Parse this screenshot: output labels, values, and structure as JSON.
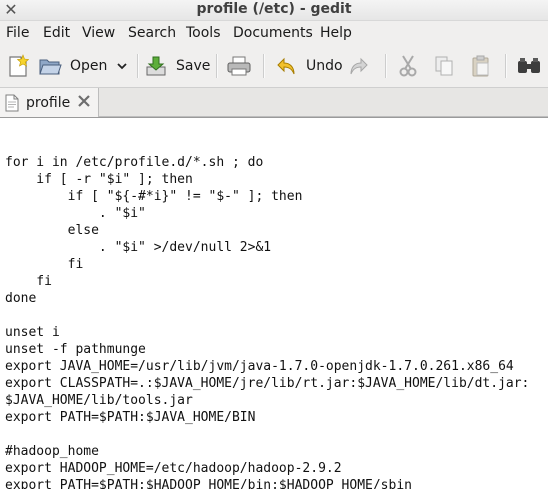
{
  "window": {
    "title": "profile (/etc) - gedit",
    "close_glyph": "✕"
  },
  "menubar": {
    "items": [
      "File",
      "Edit",
      "View",
      "Search",
      "Tools",
      "Documents",
      "Help"
    ]
  },
  "toolbar": {
    "open_label": "Open",
    "save_label": "Save",
    "undo_label": "Undo",
    "icons": [
      "new-document-icon",
      "open-icon",
      "dropdown-arrow-icon",
      "save-icon",
      "print-icon",
      "undo-icon",
      "redo-icon",
      "cut-icon",
      "copy-icon",
      "paste-icon",
      "find-icon"
    ]
  },
  "tabs": [
    {
      "label": "profile"
    }
  ],
  "editor": {
    "lines": [
      "",
      "for i in /etc/profile.d/*.sh ; do",
      "    if [ -r \"$i\" ]; then",
      "        if [ \"${-#*i}\" != \"$-\" ]; then",
      "            . \"$i\"",
      "        else",
      "            . \"$i\" >/dev/null 2>&1",
      "        fi",
      "    fi",
      "done",
      "",
      "unset i",
      "unset -f pathmunge",
      "export JAVA_HOME=/usr/lib/jvm/java-1.7.0-openjdk-1.7.0.261.x86_64",
      "export CLASSPATH=.:$JAVA_HOME/jre/lib/rt.jar:$JAVA_HOME/lib/dt.jar:",
      "$JAVA_HOME/lib/tools.jar",
      "export PATH=$PATH:$JAVA_HOME/BIN",
      "",
      "#hadoop_home",
      "export HADOOP_HOME=/etc/hadoop/hadoop-2.9.2",
      "export PATH=$PATH:$HADOOP_HOME/bin:$HADOOP_HOME/sbin"
    ]
  }
}
